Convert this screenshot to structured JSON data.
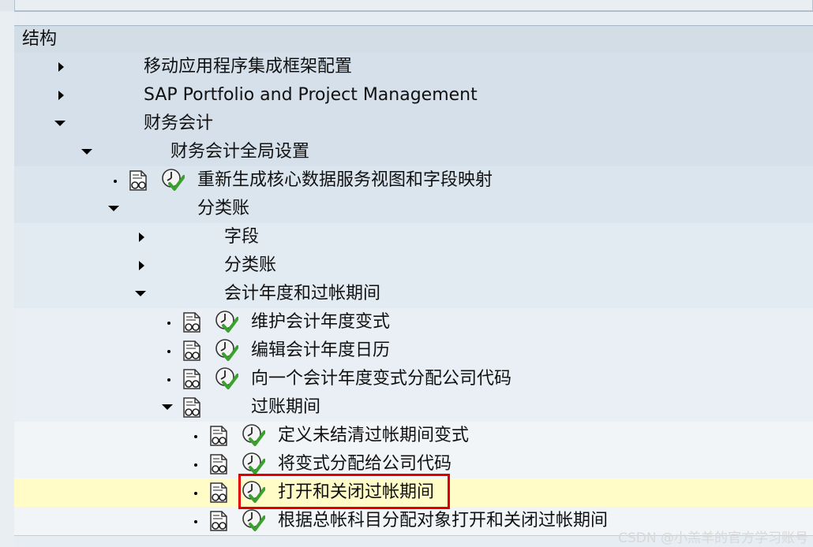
{
  "header": {
    "title": "结构"
  },
  "tree": [
    {
      "label": "移动应用程序集成框架配置",
      "node": "collapsed",
      "doc": false,
      "exec": false
    },
    {
      "label": "SAP Portfolio and Project Management",
      "node": "collapsed",
      "doc": false,
      "exec": false
    },
    {
      "label": "财务会计",
      "node": "expanded",
      "doc": false,
      "exec": false
    },
    {
      "label": "财务会计全局设置",
      "node": "expanded",
      "doc": false,
      "exec": false
    },
    {
      "label": "重新生成核心数据服务视图和字段映射",
      "node": "leaf",
      "doc": true,
      "exec": true
    },
    {
      "label": "分类账",
      "node": "expanded",
      "doc": false,
      "exec": false
    },
    {
      "label": "字段",
      "node": "collapsed",
      "doc": false,
      "exec": false
    },
    {
      "label": "分类账",
      "node": "collapsed",
      "doc": false,
      "exec": false
    },
    {
      "label": "会计年度和过帐期间",
      "node": "expanded",
      "doc": false,
      "exec": false
    },
    {
      "label": "维护会计年度变式",
      "node": "leaf",
      "doc": true,
      "exec": true
    },
    {
      "label": "编辑会计年度日历",
      "node": "leaf",
      "doc": true,
      "exec": true
    },
    {
      "label": "向一个会计年度变式分配公司代码",
      "node": "leaf",
      "doc": true,
      "exec": true
    },
    {
      "label": "过账期间",
      "node": "expanded",
      "doc": true,
      "exec": false
    },
    {
      "label": "定义未结清过帐期间变式",
      "node": "leaf",
      "doc": true,
      "exec": true
    },
    {
      "label": "将变式分配给公司代码",
      "node": "leaf",
      "doc": true,
      "exec": true
    },
    {
      "label": "打开和关闭过帐期间",
      "node": "leaf",
      "doc": true,
      "exec": true,
      "selected": true
    },
    {
      "label": "根据总帐科目分配对象打开和关闭过帐期间",
      "node": "leaf",
      "doc": true,
      "exec": true
    }
  ],
  "colors": {
    "level1": "#d5e0ea",
    "level2": "#dbe5ee",
    "level3": "#e2eaf2",
    "level4": "#e9eff5",
    "level5": "#f2f5f8",
    "selected": "#fffcc7",
    "highlight": "#e00000",
    "check": "#3aa12f"
  },
  "icons": {
    "collapsed": "triangle-right-icon",
    "expanded": "triangle-down-icon",
    "leaf": "bullet-icon",
    "doc": "document-glasses-icon",
    "exec": "clock-checkmark-icon"
  },
  "watermark": "CSDN @小羔羊的官方学习账号"
}
